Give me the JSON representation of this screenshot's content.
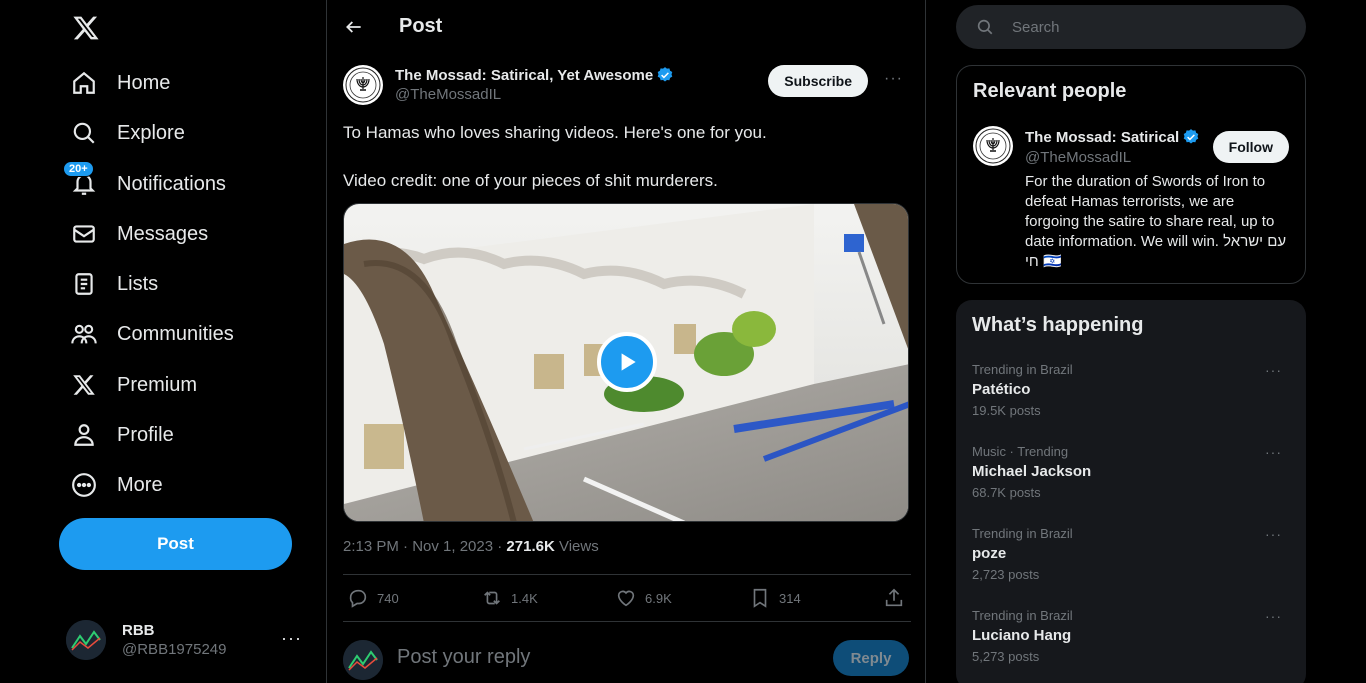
{
  "nav": {
    "items": [
      {
        "label": "Home",
        "icon": "home-icon"
      },
      {
        "label": "Explore",
        "icon": "search-icon"
      },
      {
        "label": "Notifications",
        "icon": "bell-icon",
        "badge": "20+"
      },
      {
        "label": "Messages",
        "icon": "envelope-icon"
      },
      {
        "label": "Lists",
        "icon": "list-icon"
      },
      {
        "label": "Communities",
        "icon": "people-icon"
      },
      {
        "label": "Premium",
        "icon": "x-logo-icon"
      },
      {
        "label": "Profile",
        "icon": "person-icon"
      },
      {
        "label": "More",
        "icon": "more-circle-icon"
      }
    ],
    "post_label": "Post",
    "account": {
      "name": "RBB",
      "handle": "@RBB1975249",
      "more": "···"
    }
  },
  "main": {
    "header_title": "Post",
    "author": {
      "name": "The Mossad: Satirical, Yet Awesome",
      "handle": "@TheMossadIL",
      "subscribe_label": "Subscribe",
      "more": "···"
    },
    "text_lines": [
      "To Hamas who loves sharing videos. Here's one for you.",
      "Video credit: one of your pieces of shit murderers."
    ],
    "meta": {
      "time": "2:13 PM · Nov 1, 2023 · ",
      "views_count": "271.6K",
      "views_label": " Views"
    },
    "actions": {
      "replies": "740",
      "reposts": "1.4K",
      "likes": "6.9K",
      "bookmarks": "314"
    },
    "reply": {
      "placeholder": "Post your reply",
      "button": "Reply"
    }
  },
  "right": {
    "search_placeholder": "Search",
    "relevant": {
      "title": "Relevant people",
      "name": "The Mossad: Satirical",
      "handle": "@TheMossadIL",
      "follow_label": "Follow",
      "bio": "For the duration of Swords of Iron to defeat Hamas terrorists, we are forgoing the satire to share real, up to date information. We will win. עם ישראל חי 🇮🇱"
    },
    "happening": {
      "title": "What’s happening",
      "trends": [
        {
          "context": "Trending in Brazil",
          "title": "Patético",
          "count": "19.5K posts"
        },
        {
          "context": "Music · Trending",
          "title": "Michael Jackson",
          "count": "68.7K posts"
        },
        {
          "context": "Trending in Brazil",
          "title": "poze",
          "count": "2,723 posts"
        },
        {
          "context": "Trending in Brazil",
          "title": "Luciano Hang",
          "count": "5,273 posts"
        }
      ]
    }
  },
  "colors": {
    "accent": "#1d9bf0",
    "text": "#e7e9ea",
    "muted": "#71767b",
    "border": "#2f3336"
  }
}
